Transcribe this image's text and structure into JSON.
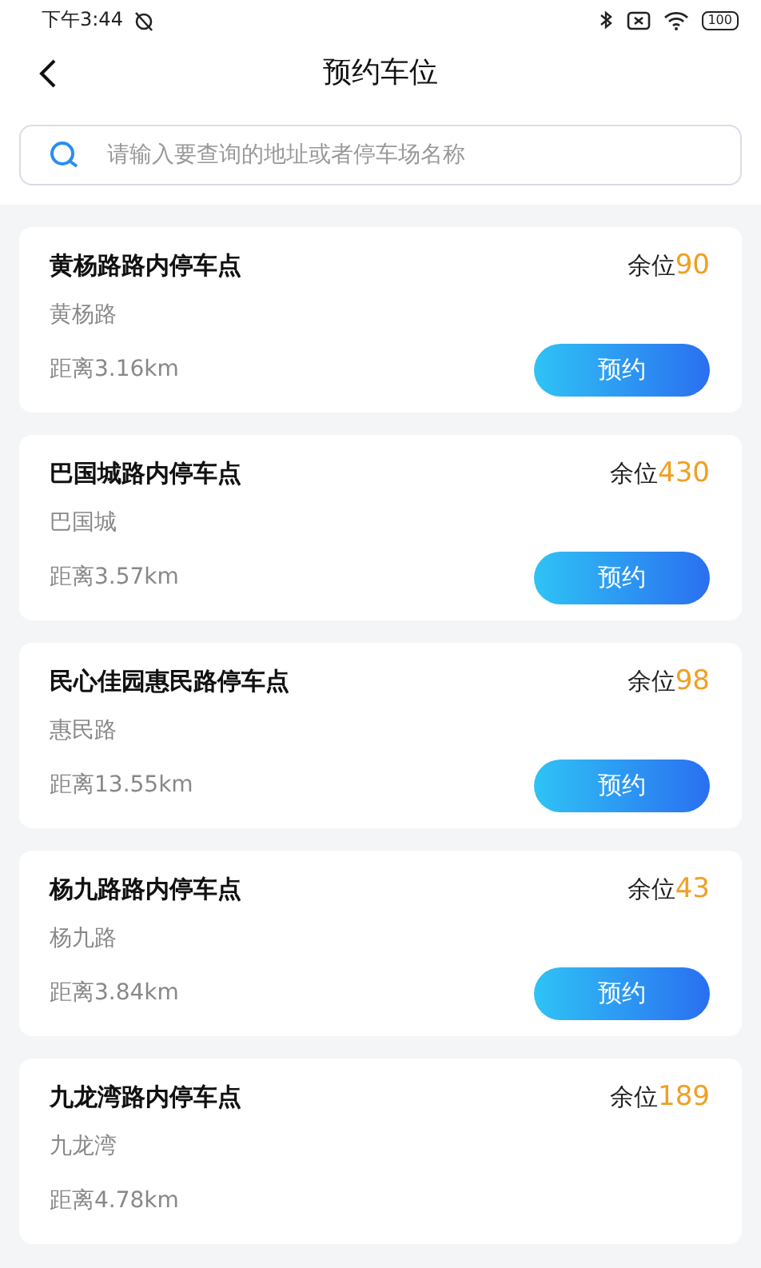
{
  "status_bar": {
    "time": "下午3:44",
    "battery": "100"
  },
  "header": {
    "title": "预约车位"
  },
  "search": {
    "placeholder": "请输入要查询的地址或者停车场名称"
  },
  "lots": [
    {
      "name": "黄杨路路内停车点",
      "remaining_label": "余位",
      "remaining": "90",
      "address": "黄杨路",
      "distance": "距离3.16km",
      "button": "预约"
    },
    {
      "name": "巴国城路内停车点",
      "remaining_label": "余位",
      "remaining": "430",
      "address": "巴国城",
      "distance": "距离3.57km",
      "button": "预约"
    },
    {
      "name": "民心佳园惠民路停车点",
      "remaining_label": "余位",
      "remaining": "98",
      "address": "惠民路",
      "distance": "距离13.55km",
      "button": "预约"
    },
    {
      "name": "杨九路路内停车点",
      "remaining_label": "余位",
      "remaining": "43",
      "address": "杨九路",
      "distance": "距离3.84km",
      "button": "预约"
    },
    {
      "name": "九龙湾路内停车点",
      "remaining_label": "余位",
      "remaining": "189",
      "address": "九龙湾",
      "distance": "距离4.78km"
    }
  ]
}
